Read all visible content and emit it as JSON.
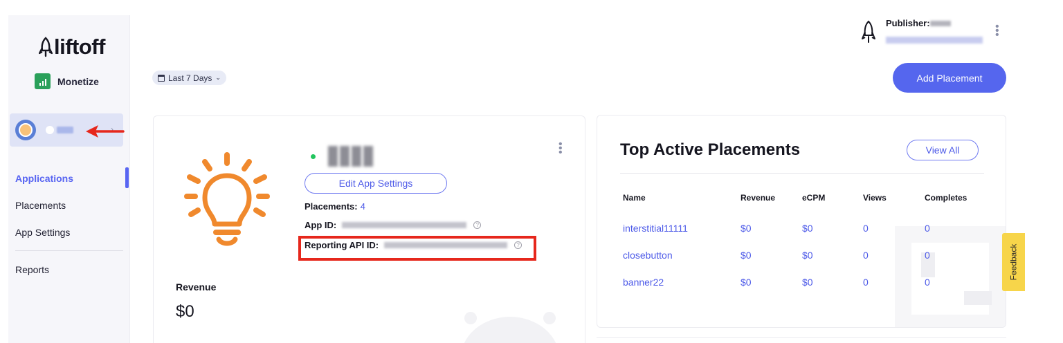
{
  "sidebar": {
    "logo_text": "liftoff",
    "product_label": "Monetize",
    "nav_items": [
      {
        "label": "Applications",
        "active": true
      },
      {
        "label": "Placements",
        "active": false
      },
      {
        "label": "App Settings",
        "active": false
      }
    ],
    "reports_label": "Reports"
  },
  "header": {
    "date_range": "Last 7 Days",
    "publisher_label": "Publisher:",
    "add_placement_label": "Add Placement"
  },
  "app_card": {
    "edit_settings_label": "Edit App Settings",
    "placements_label": "Placements:",
    "placements_count": "4",
    "app_id_label": "App ID:",
    "reporting_api_label": "Reporting API ID:",
    "revenue_label": "Revenue",
    "revenue_value": "$0"
  },
  "top_placements": {
    "title": "Top Active Placements",
    "view_all_label": "View All",
    "columns": [
      "Name",
      "Revenue",
      "eCPM",
      "Views",
      "Completes"
    ],
    "rows": [
      [
        "interstitial11111",
        "$0",
        "$0",
        "0",
        "0"
      ],
      [
        "closebutton",
        "$0",
        "$0",
        "0",
        "0"
      ],
      [
        "banner22",
        "$0",
        "$0",
        "0",
        "0"
      ]
    ]
  },
  "feedback_label": "Feedback",
  "colors": {
    "accent": "#5566ee",
    "link": "#4d5ae8",
    "highlight": "#e6271c",
    "bulb": "#f0892d",
    "status_online": "#22c55e",
    "feedback": "#f7d54a"
  },
  "icons": {
    "logo": "rocket-icon",
    "app_icon": "lightbulb-icon",
    "help": "question-circle-icon"
  }
}
